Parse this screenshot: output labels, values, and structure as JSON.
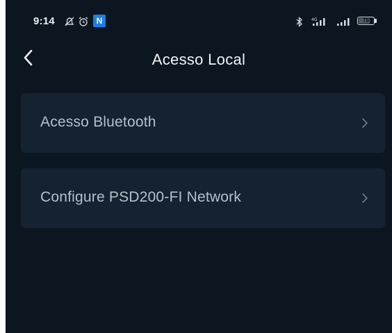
{
  "status_bar": {
    "time": "9:14",
    "notification_badge": "N",
    "battery_level": "78",
    "battery_fraction": 0.78,
    "icons": [
      "alarm-off-icon",
      "alarm-clock-icon",
      "bluetooth-icon",
      "signal-4g-icon",
      "signal-icon",
      "battery-icon"
    ]
  },
  "header": {
    "title": "Acesso Local",
    "back_icon": "chevron-left-icon"
  },
  "items": [
    {
      "label": "Acesso Bluetooth",
      "icon": "chevron-right-icon"
    },
    {
      "label": "Configure PSD200-FI Network",
      "icon": "chevron-right-icon"
    }
  ],
  "colors": {
    "background": "#0c1620",
    "card": "#142231",
    "title_text": "#f2f4f6",
    "item_text": "#b6c0cb",
    "badge_blue": "#1f7fe3"
  }
}
